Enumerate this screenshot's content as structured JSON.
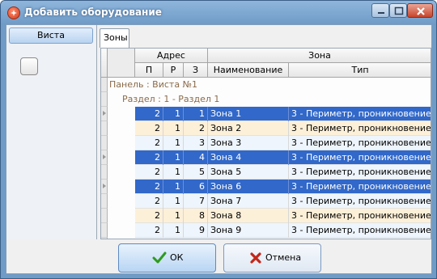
{
  "window": {
    "title": "Добавить оборудование"
  },
  "left_panel": {
    "vista_label": "Виста"
  },
  "tabs": [
    {
      "label": "Зоны"
    }
  ],
  "grid": {
    "group_headers": {
      "address": "Адрес",
      "zone": "Зона"
    },
    "columns": [
      "П",
      "Р",
      "З",
      "Наименование",
      "Тип"
    ],
    "panel_label": "Панель : Виста №1",
    "section_label": "Раздел : 1 - Раздел 1",
    "rows": [
      {
        "p": "2",
        "r": "1",
        "z": "1",
        "name": "Зона 1",
        "type": "3 - Периметр, проникновение",
        "state": "selected"
      },
      {
        "p": "2",
        "r": "1",
        "z": "2",
        "name": "Зона 2",
        "type": "3 - Периметр, проникновение",
        "state": "alt"
      },
      {
        "p": "2",
        "r": "1",
        "z": "3",
        "name": "Зона 3",
        "type": "3 - Периметр, проникновение",
        "state": "plain"
      },
      {
        "p": "2",
        "r": "1",
        "z": "4",
        "name": "Зона 4",
        "type": "3 - Периметр, проникновение",
        "state": "selected"
      },
      {
        "p": "2",
        "r": "1",
        "z": "5",
        "name": "Зона 5",
        "type": "3 - Периметр, проникновение",
        "state": "plain"
      },
      {
        "p": "2",
        "r": "1",
        "z": "6",
        "name": "Зона 6",
        "type": "3 - Периметр, проникновение",
        "state": "selected"
      },
      {
        "p": "2",
        "r": "1",
        "z": "7",
        "name": "Зона 7",
        "type": "3 - Периметр, проникновение",
        "state": "plain"
      },
      {
        "p": "2",
        "r": "1",
        "z": "8",
        "name": "Зона 8",
        "type": "3 - Периметр, проникновение",
        "state": "alt"
      },
      {
        "p": "2",
        "r": "1",
        "z": "9",
        "name": "Зона 9",
        "type": "3 - Периметр, проникновение",
        "state": "plain"
      }
    ]
  },
  "buttons": {
    "ok": "ОК",
    "cancel": "Отмена"
  },
  "colors": {
    "selection": "#3168c9",
    "title_bar": "#6f9bc6",
    "ok_icon": "#2e9b1e",
    "cancel_icon": "#c4261a"
  }
}
